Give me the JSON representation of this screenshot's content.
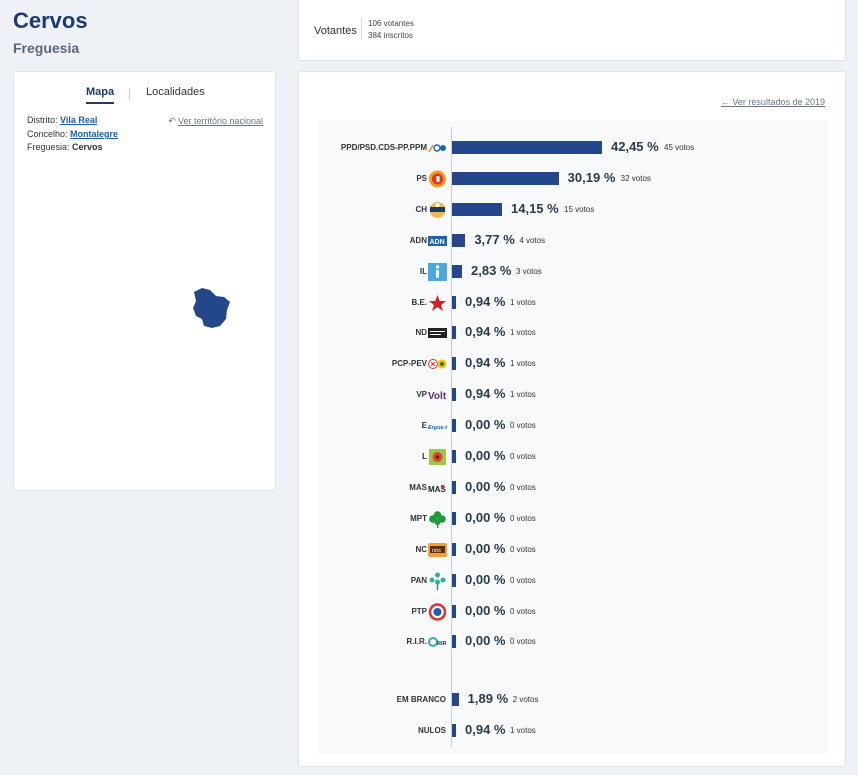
{
  "header": {
    "title": "Cervos",
    "subtitle": "Freguesia"
  },
  "map_panel": {
    "tabs": [
      "Mapa",
      "Localidades"
    ],
    "distrito_label": "Distrito:",
    "distrito_value": "Vila Real",
    "concelho_label": "Concelho:",
    "concelho_value": "Montalegre",
    "freguesia_label": "Freguesia:",
    "freguesia_value": "Cervos",
    "national_link": "Ver território nacional",
    "map_color": "#24478c"
  },
  "votantes": {
    "label": "Votantes",
    "votantes": "106 votantes",
    "inscritos": "384 inscritos"
  },
  "results": {
    "previous_link": "Ver resultados de 2019",
    "bar_color": "#24478c",
    "chart_data": {
      "type": "bar",
      "orientation": "horizontal",
      "categories": [
        "PPD/PSD.CDS-PP.PPM",
        "PS",
        "CH",
        "ADN",
        "IL",
        "B.E.",
        "ND",
        "PCP-PEV",
        "VP",
        "E",
        "L",
        "MAS",
        "MPT",
        "NC",
        "PAN",
        "PTP",
        "R.I.R.",
        "EM BRANCO",
        "NULOS"
      ],
      "values": [
        42.45,
        30.19,
        14.15,
        3.77,
        2.83,
        0.94,
        0.94,
        0.94,
        0.94,
        0.0,
        0.0,
        0.0,
        0.0,
        0.0,
        0.0,
        0.0,
        0.0,
        1.89,
        0.94
      ],
      "pct_labels": [
        "42,45 %",
        "30,19 %",
        "14,15 %",
        "3,77 %",
        "2,83 %",
        "0,94 %",
        "0,94 %",
        "0,94 %",
        "0,94 %",
        "0,00 %",
        "0,00 %",
        "0,00 %",
        "0,00 %",
        "0,00 %",
        "0,00 %",
        "0,00 %",
        "0,00 %",
        "1,89 %",
        "0,94 %"
      ],
      "votes_labels": [
        "45 votos",
        "32 votos",
        "15 votos",
        "4 votos",
        "3 votos",
        "1 votos",
        "1 votos",
        "1 votos",
        "1 votos",
        "0 votos",
        "0 votos",
        "0 votos",
        "0 votos",
        "0 votos",
        "0 votos",
        "0 votos",
        "0 votos",
        "2 votos",
        "1 votos"
      ],
      "logos": [
        "psd-cds-ppm-logo",
        "ps-logo",
        "chega-logo",
        "adn-logo",
        "il-logo",
        "be-logo",
        "nd-logo",
        "cdu-logo",
        "volt-logo",
        "ergue-te-logo",
        "livre-logo",
        "mas-logo",
        "mpt-logo",
        "nos-cidadaos-logo",
        "pan-logo",
        "ptp-logo",
        "rir-logo",
        "",
        ""
      ]
    }
  }
}
